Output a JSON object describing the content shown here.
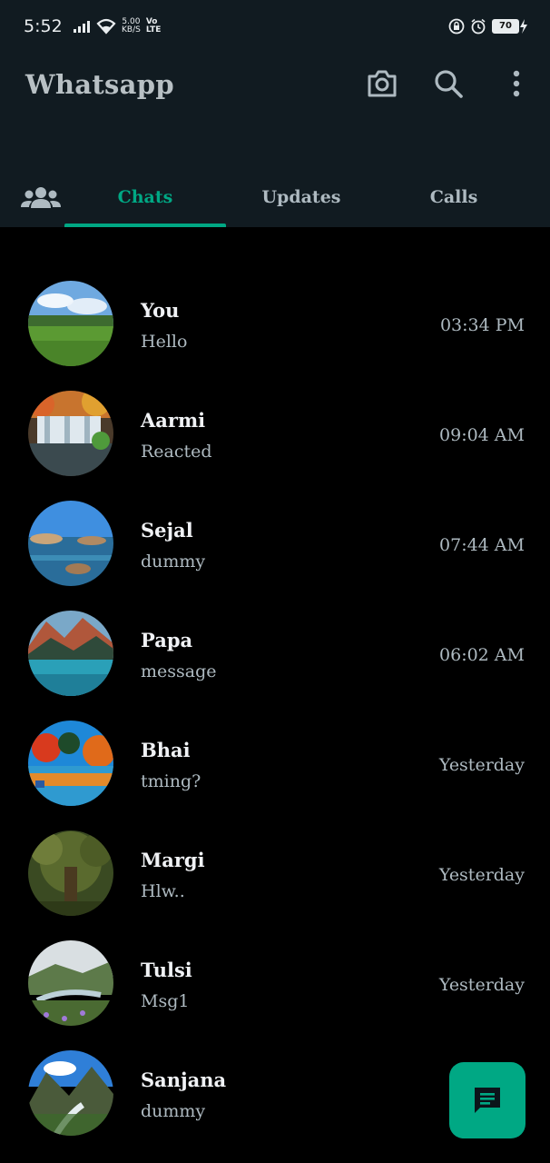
{
  "status_bar": {
    "time": "5:52",
    "speed_value": "5.00",
    "speed_unit": "KB/S",
    "volte_top": "Vo",
    "volte_bottom": "LTE",
    "battery": "70"
  },
  "app_bar": {
    "title": "Whatsapp",
    "icons": [
      "camera-icon",
      "search-icon",
      "more-vert-icon"
    ]
  },
  "tabs": {
    "community_icon": "community-icon",
    "items": [
      {
        "label": "Chats",
        "active": true
      },
      {
        "label": "Updates",
        "active": false
      },
      {
        "label": "Calls",
        "active": false
      }
    ]
  },
  "chats": [
    {
      "name": "You",
      "message": "Hello",
      "time": "03:34 PM",
      "avatar": "meadow-sky"
    },
    {
      "name": "Aarmi",
      "message": "Reacted",
      "time": "09:04 AM",
      "avatar": "waterfall-autumn"
    },
    {
      "name": "Sejal",
      "message": "dummy",
      "time": "07:44 AM",
      "avatar": "lake-rocks"
    },
    {
      "name": "Papa",
      "message": "message",
      "time": "06:02 AM",
      "avatar": "mountain-lake"
    },
    {
      "name": "Bhai",
      "message": "tming?",
      "time": "Yesterday",
      "avatar": "autumn-trees"
    },
    {
      "name": "Margi",
      "message": "Hlw..",
      "time": "Yesterday",
      "avatar": "forest-tree"
    },
    {
      "name": "Tulsi",
      "message": "Msg1",
      "time": "Yesterday",
      "avatar": "valley-river"
    },
    {
      "name": "Sanjana",
      "message": "dummy",
      "time": "Y",
      "avatar": "mountain-stream"
    }
  ],
  "fab": {
    "icon": "new-chat-icon"
  },
  "colors": {
    "accent": "#00a884",
    "header_bg": "#111b21",
    "background": "#000000",
    "secondary_text": "#aebac1"
  }
}
